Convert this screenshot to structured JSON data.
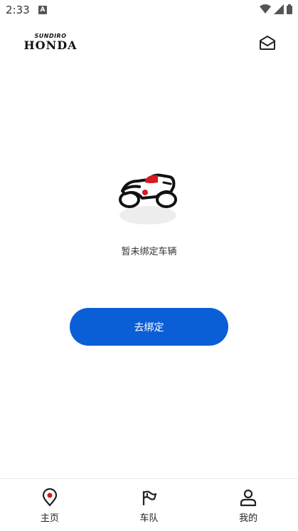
{
  "status_bar": {
    "time": "2:33",
    "notification_icon": "a",
    "icons": [
      "wifi-icon",
      "signal-icon",
      "battery-icon"
    ]
  },
  "header": {
    "brand_top": "SUNDIRO",
    "brand_main": "HONDA",
    "mail_icon": "mail-open-icon"
  },
  "empty_state": {
    "message": "暂未绑定车辆",
    "illustration": "motorcycle-icon"
  },
  "bind_button": {
    "label": "去绑定",
    "color": "#0b5fd6"
  },
  "tabbar": {
    "tabs": [
      {
        "label": "主页",
        "icon": "location-pin-icon"
      },
      {
        "label": "车队",
        "icon": "flag-icon"
      },
      {
        "label": "我的",
        "icon": "user-icon"
      }
    ]
  }
}
